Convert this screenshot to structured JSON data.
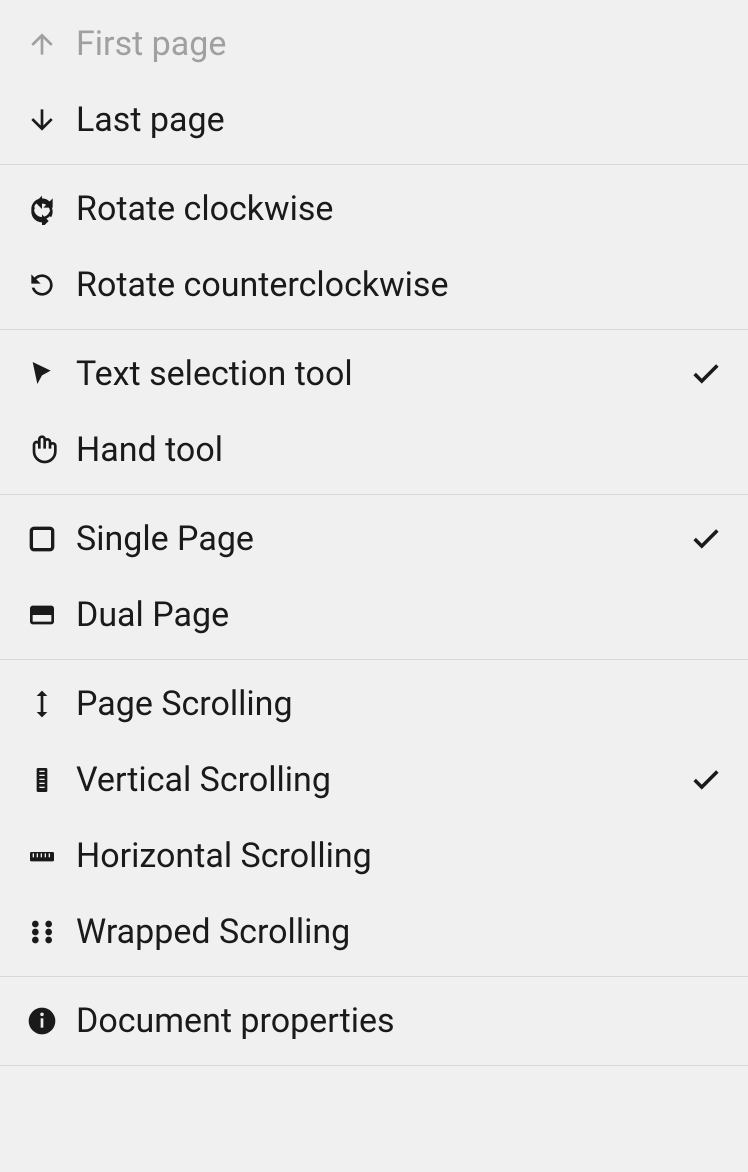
{
  "menu": {
    "navigation": {
      "first_page": "First page",
      "last_page": "Last page"
    },
    "rotation": {
      "rotate_cw": "Rotate clockwise",
      "rotate_ccw": "Rotate counterclockwise"
    },
    "tools": {
      "text_selection": "Text selection tool",
      "hand_tool": "Hand tool"
    },
    "page_layout": {
      "single_page": "Single Page",
      "dual_page": "Dual Page"
    },
    "scrolling": {
      "page_scrolling": "Page Scrolling",
      "vertical_scrolling": "Vertical Scrolling",
      "horizontal_scrolling": "Horizontal Scrolling",
      "wrapped_scrolling": "Wrapped Scrolling"
    },
    "info": {
      "document_properties": "Document properties"
    }
  },
  "selected": {
    "tool": "text_selection",
    "page_layout": "single_page",
    "scrolling": "vertical_scrolling"
  }
}
